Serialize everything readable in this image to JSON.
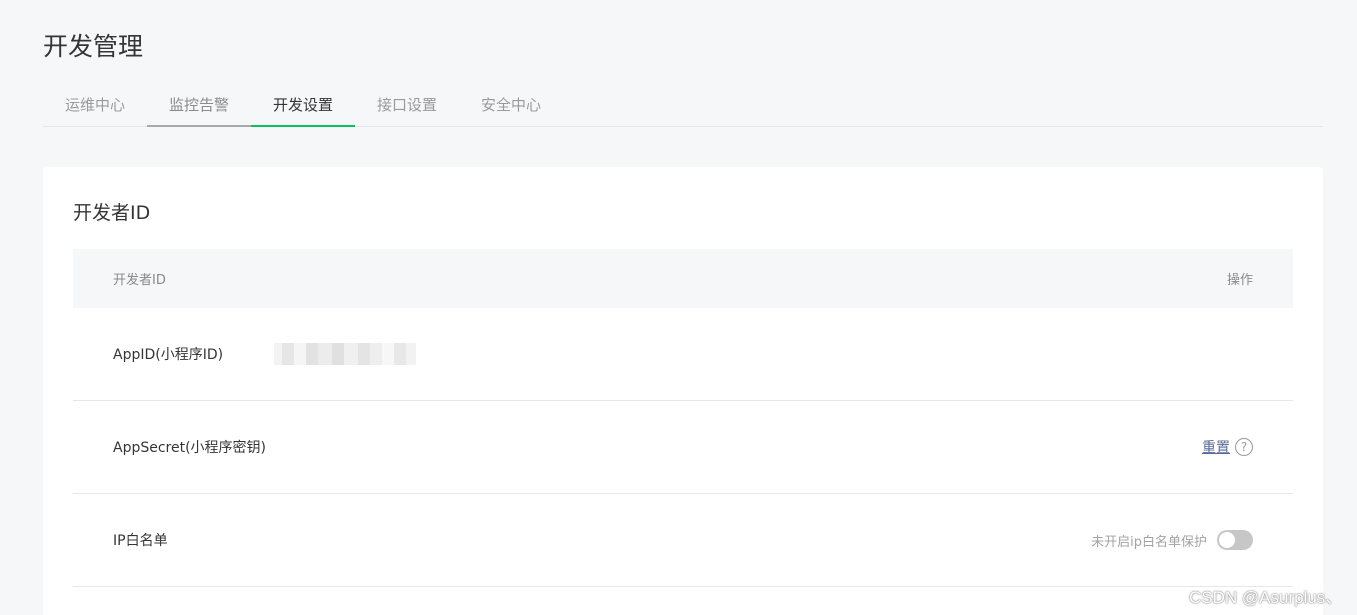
{
  "page": {
    "title": "开发管理"
  },
  "tabs": [
    {
      "label": "运维中心",
      "state": "normal"
    },
    {
      "label": "监控告警",
      "state": "hover"
    },
    {
      "label": "开发设置",
      "state": "active"
    },
    {
      "label": "接口设置",
      "state": "normal"
    },
    {
      "label": "安全中心",
      "state": "normal"
    }
  ],
  "colors": {
    "accent": "#07c160",
    "link": "#576b95",
    "hover_underline": "#a9a9a9"
  },
  "developer_id": {
    "section_title": "开发者ID",
    "columns": {
      "left": "开发者ID",
      "right": "操作"
    },
    "rows": {
      "appid": {
        "label": "AppID(小程序ID)"
      },
      "appsecret": {
        "label": "AppSecret(小程序密钥)",
        "action": "重置",
        "help_icon": "question-icon"
      },
      "ip_whitelist": {
        "label": "IP白名单",
        "status": "未开启ip白名单保护",
        "toggle_on": false
      }
    }
  },
  "watermark": "CSDN @Asurplus、"
}
